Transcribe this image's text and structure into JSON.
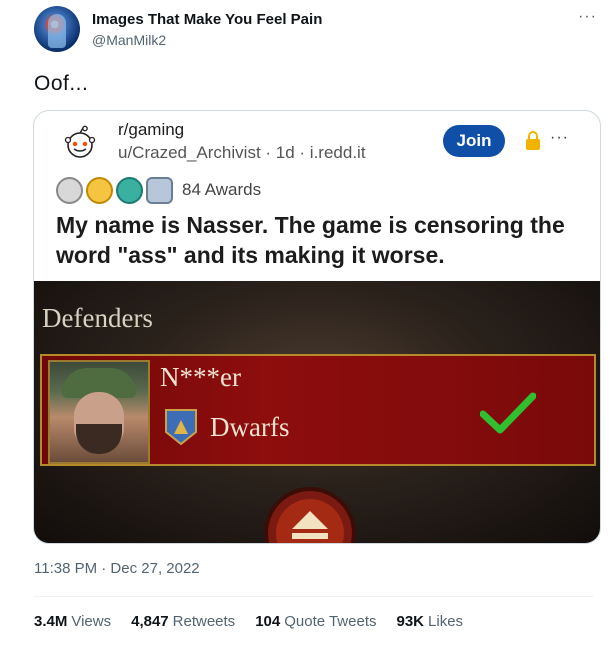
{
  "tweet": {
    "author_name": "Images That Make You Feel Pain",
    "author_handle": "@ManMilk2",
    "text": "Oof...",
    "more_label": "···",
    "timestamp": "11:38 PM · Dec 27, 2022",
    "stats": [
      {
        "value": "3.4M",
        "label": "Views"
      },
      {
        "value": "4,847",
        "label": "Retweets"
      },
      {
        "value": "104",
        "label": "Quote Tweets"
      },
      {
        "value": "93K",
        "label": "Likes"
      }
    ]
  },
  "reddit_card": {
    "subreddit": "r/gaming",
    "meta": "u/Crazed_Archivist · 1d · i.redd.it",
    "join_label": "Join",
    "more_label": "···",
    "awards_count": "84 Awards",
    "title": "My name is Nasser. The game is censoring the word \"ass\" and its making it worse.",
    "colors": {
      "join": "#0f4fa8",
      "lock": "#f0b400"
    }
  },
  "game_screenshot": {
    "heading": "Defenders",
    "player_name": "N***er",
    "faction": "Dwarfs",
    "icons": [
      "player-portrait",
      "dwarf-crest-icon",
      "checkmark-icon",
      "emblem-icon"
    ],
    "colors": {
      "banner": "#8e0d0d",
      "border": "#b48a2a",
      "check": "#2fbf2f"
    }
  }
}
